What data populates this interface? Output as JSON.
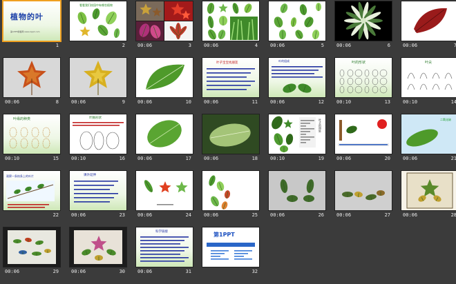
{
  "slides": [
    {
      "number": "1",
      "time": "",
      "title": "植物的叶",
      "subtitle": "第1PPT模板网 www.1ppt.com",
      "type": "title"
    },
    {
      "number": "2",
      "time": "",
      "title": "看看我们校园中有哪些植物",
      "type": "leafscatter"
    },
    {
      "number": "3",
      "time": "00:06",
      "title": "",
      "type": "collage"
    },
    {
      "number": "4",
      "time": "00:06",
      "title": "",
      "type": "leafgrid"
    },
    {
      "number": "5",
      "time": "00:06",
      "title": "",
      "type": "leafpairs"
    },
    {
      "number": "6",
      "time": "00:06",
      "title": "",
      "type": "darkplant"
    },
    {
      "number": "7",
      "time": "00:06",
      "title": "",
      "type": "redleaf"
    },
    {
      "number": "8",
      "time": "00:06",
      "title": "",
      "type": "mapleleaf"
    },
    {
      "number": "9",
      "time": "00:06",
      "title": "",
      "type": "yellowleaf"
    },
    {
      "number": "10",
      "time": "00:06",
      "title": "",
      "type": "greenleaf"
    },
    {
      "number": "11",
      "time": "00:06",
      "title": "叶子宝宝找朋友",
      "type": "text"
    },
    {
      "number": "12",
      "time": "00:06",
      "title": "叶的组成",
      "type": "leafparts"
    },
    {
      "number": "13",
      "time": "00:10",
      "title": "叶的形状",
      "type": "shapes"
    },
    {
      "number": "14",
      "time": "00:10",
      "title": "叶尖",
      "type": "tips"
    },
    {
      "number": "15",
      "time": "00:10",
      "title": "叶缘的种类",
      "type": "margins"
    },
    {
      "number": "16",
      "time": "00:10",
      "title": "叶脉形状",
      "type": "veins"
    },
    {
      "number": "17",
      "time": "00:06",
      "title": "",
      "type": "bigleaf"
    },
    {
      "number": "18",
      "time": "00:06",
      "title": "",
      "type": "photoleaf"
    },
    {
      "number": "19",
      "time": "00:10",
      "title": "叶子的用处",
      "type": "uses"
    },
    {
      "number": "20",
      "time": "00:06",
      "title": "",
      "type": "process"
    },
    {
      "number": "21",
      "time": "00:06",
      "title": "二氧化碳",
      "type": "co2"
    },
    {
      "number": "22",
      "time": "",
      "title": "观察一条枝条上的叶片",
      "type": "branch"
    },
    {
      "number": "23",
      "time": "00:06",
      "title": "课外延伸",
      "type": "text2"
    },
    {
      "number": "24",
      "time": "00:06",
      "title": "",
      "type": "craft1"
    },
    {
      "number": "25",
      "time": "00:06",
      "title": "",
      "type": "craft2"
    },
    {
      "number": "26",
      "time": "00:06",
      "title": "",
      "type": "art1"
    },
    {
      "number": "27",
      "time": "00:06",
      "title": "",
      "type": "art2"
    },
    {
      "number": "28",
      "time": "00:06",
      "title": "",
      "type": "art3"
    },
    {
      "number": "29",
      "time": "00:06",
      "title": "",
      "type": "art4"
    },
    {
      "number": "30",
      "time": "00:06",
      "title": "",
      "type": "art5"
    },
    {
      "number": "31",
      "time": "00:06",
      "title": "科学链接",
      "type": "text3"
    },
    {
      "number": "32",
      "time": "",
      "title": "第1PPT",
      "type": "brand"
    }
  ]
}
